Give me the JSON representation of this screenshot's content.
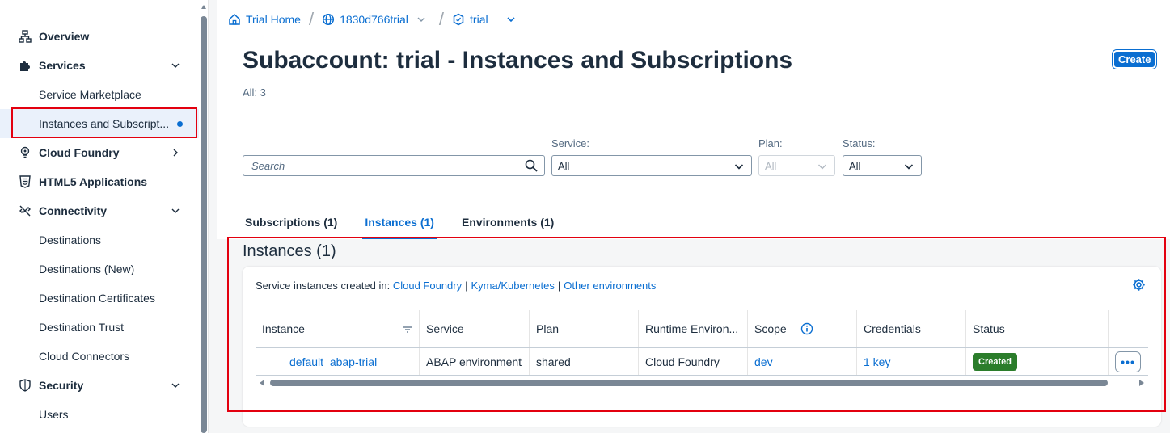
{
  "colors": {
    "accent": "#0a6ed1",
    "status_created": "#2b7d2b",
    "highlight": "#e3000f"
  },
  "sidebar": {
    "items": [
      {
        "label": "Overview",
        "icon": "hierarchy-icon",
        "level": "top"
      },
      {
        "label": "Services",
        "icon": "puzzle-icon",
        "level": "top",
        "chevron": "down"
      },
      {
        "label": "Service Marketplace",
        "level": "sub"
      },
      {
        "label": "Instances and Subscript...",
        "level": "sub",
        "selected": true
      },
      {
        "label": "Cloud Foundry",
        "icon": "lightbulb-icon",
        "level": "top",
        "chevron": "right"
      },
      {
        "label": "HTML5 Applications",
        "icon": "html5-icon",
        "level": "top"
      },
      {
        "label": "Connectivity",
        "icon": "connectivity-icon",
        "level": "top",
        "chevron": "down"
      },
      {
        "label": "Destinations",
        "level": "sub"
      },
      {
        "label": "Destinations (New)",
        "level": "sub"
      },
      {
        "label": "Destination Certificates",
        "level": "sub"
      },
      {
        "label": "Destination Trust",
        "level": "sub"
      },
      {
        "label": "Cloud Connectors",
        "level": "sub"
      },
      {
        "label": "Security",
        "icon": "shield-icon",
        "level": "top",
        "chevron": "down"
      },
      {
        "label": "Users",
        "level": "sub"
      }
    ]
  },
  "breadcrumb": {
    "home": "Trial Home",
    "global_account": "1830d766trial",
    "subaccount": "trial"
  },
  "header": {
    "title": "Subaccount: trial - Instances and Subscriptions",
    "count": "All: 3",
    "create_label": "Create"
  },
  "filters": {
    "search_placeholder": "Search",
    "service_label": "Service:",
    "service_value": "All",
    "plan_label": "Plan:",
    "plan_value": "All",
    "status_label": "Status:",
    "status_value": "All"
  },
  "tabs": [
    {
      "label": "Subscriptions (1)"
    },
    {
      "label": "Instances (1)",
      "active": true
    },
    {
      "label": "Environments (1)"
    }
  ],
  "section": {
    "title": "Instances (1)",
    "info_prefix": "Service instances created in:",
    "links": [
      "Cloud Foundry",
      "Kyma/Kubernetes",
      "Other environments"
    ]
  },
  "table": {
    "columns": [
      "Instance",
      "Service",
      "Plan",
      "Runtime Environ...",
      "Scope",
      "Credentials",
      "Status",
      ""
    ],
    "rows": [
      {
        "instance": "default_abap-trial",
        "service": "ABAP environment",
        "plan": "shared",
        "runtime": "Cloud Foundry",
        "scope": "dev",
        "credentials": "1 key",
        "status": "Created",
        "actions": "•••"
      }
    ]
  }
}
